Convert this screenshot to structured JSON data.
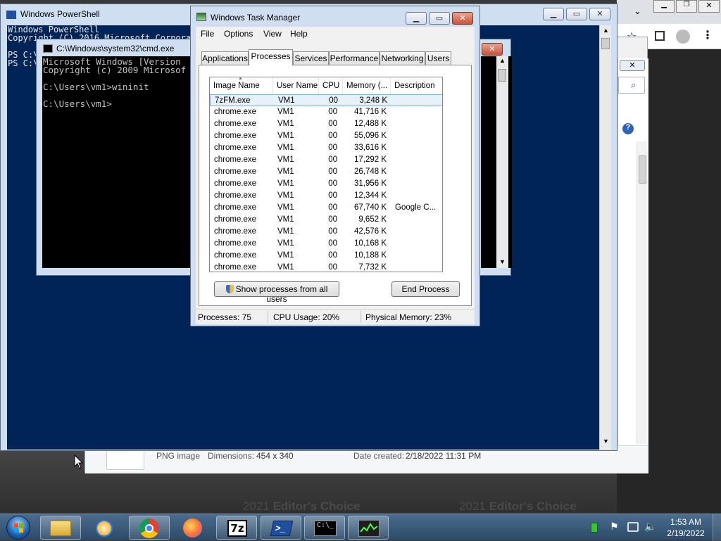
{
  "colors": {
    "powershell_bg": "#012456",
    "cmd_bg": "#000000",
    "window_frame": "#cfdff1",
    "taskbar": "#3c5a7b",
    "selection": "#e6f1fb"
  },
  "background": {
    "promo_left": {
      "year": "2021",
      "text": "Editor's Choice"
    },
    "promo_right": {
      "year": "2021",
      "text": "Editor's Choice"
    }
  },
  "explorer": {
    "file_type": "PNG image",
    "dimensions_label": "Dimensions:",
    "dimensions_value": "454 x 340",
    "date_label": "Date created:",
    "date_value": "2/18/2022 11:31 PM"
  },
  "powershell": {
    "title": "Windows PowerShell",
    "lines": [
      "Windows PowerShell",
      "Copyright (C) 2016 Microsoft Corporat",
      "",
      "PS C:\\",
      "PS C:\\"
    ]
  },
  "cmd": {
    "title": "C:\\Windows\\system32\\cmd.exe",
    "lines": [
      "Microsoft Windows [Version",
      "Copyright (c) 2009 Microsof",
      "",
      "C:\\Users\\vm1>wininit",
      "",
      "C:\\Users\\vm1>"
    ]
  },
  "taskmgr": {
    "title": "Windows Task Manager",
    "menu": [
      "File",
      "Options",
      "View",
      "Help"
    ],
    "tabs": [
      "Applications",
      "Processes",
      "Services",
      "Performance",
      "Networking",
      "Users"
    ],
    "active_tab": "Processes",
    "columns": [
      "Image Name",
      "User Name",
      "CPU",
      "Memory (...",
      "Description"
    ],
    "rows": [
      {
        "image": "7zFM.exe",
        "user": "VM1",
        "cpu": "00",
        "mem": "3,248 K",
        "desc": ""
      },
      {
        "image": "chrome.exe",
        "user": "VM1",
        "cpu": "00",
        "mem": "41,716 K",
        "desc": ""
      },
      {
        "image": "chrome.exe",
        "user": "VM1",
        "cpu": "00",
        "mem": "12,488 K",
        "desc": ""
      },
      {
        "image": "chrome.exe",
        "user": "VM1",
        "cpu": "00",
        "mem": "55,096 K",
        "desc": ""
      },
      {
        "image": "chrome.exe",
        "user": "VM1",
        "cpu": "00",
        "mem": "33,616 K",
        "desc": ""
      },
      {
        "image": "chrome.exe",
        "user": "VM1",
        "cpu": "00",
        "mem": "17,292 K",
        "desc": ""
      },
      {
        "image": "chrome.exe",
        "user": "VM1",
        "cpu": "00",
        "mem": "26,748 K",
        "desc": ""
      },
      {
        "image": "chrome.exe",
        "user": "VM1",
        "cpu": "00",
        "mem": "31,956 K",
        "desc": ""
      },
      {
        "image": "chrome.exe",
        "user": "VM1",
        "cpu": "00",
        "mem": "12,344 K",
        "desc": ""
      },
      {
        "image": "chrome.exe",
        "user": "VM1",
        "cpu": "00",
        "mem": "67,740 K",
        "desc": "Google C..."
      },
      {
        "image": "chrome.exe",
        "user": "VM1",
        "cpu": "00",
        "mem": "9,652 K",
        "desc": ""
      },
      {
        "image": "chrome.exe",
        "user": "VM1",
        "cpu": "00",
        "mem": "42,576 K",
        "desc": ""
      },
      {
        "image": "chrome.exe",
        "user": "VM1",
        "cpu": "00",
        "mem": "10,168 K",
        "desc": ""
      },
      {
        "image": "chrome.exe",
        "user": "VM1",
        "cpu": "00",
        "mem": "10,188 K",
        "desc": ""
      },
      {
        "image": "chrome.exe",
        "user": "VM1",
        "cpu": "00",
        "mem": "7,732 K",
        "desc": ""
      }
    ],
    "show_all_button": "Show processes from all users",
    "end_process_button": "End Process",
    "status": {
      "processes": "Processes: 75",
      "cpu": "CPU Usage: 20%",
      "memory": "Physical Memory: 23%"
    }
  },
  "taskbar": {
    "apps": [
      "start-orb",
      "windows-explorer",
      "media-player",
      "google-chrome",
      "firefox",
      "7-zip",
      "powershell",
      "cmd",
      "task-manager"
    ],
    "time": "1:53 AM",
    "date": "2/19/2022"
  }
}
